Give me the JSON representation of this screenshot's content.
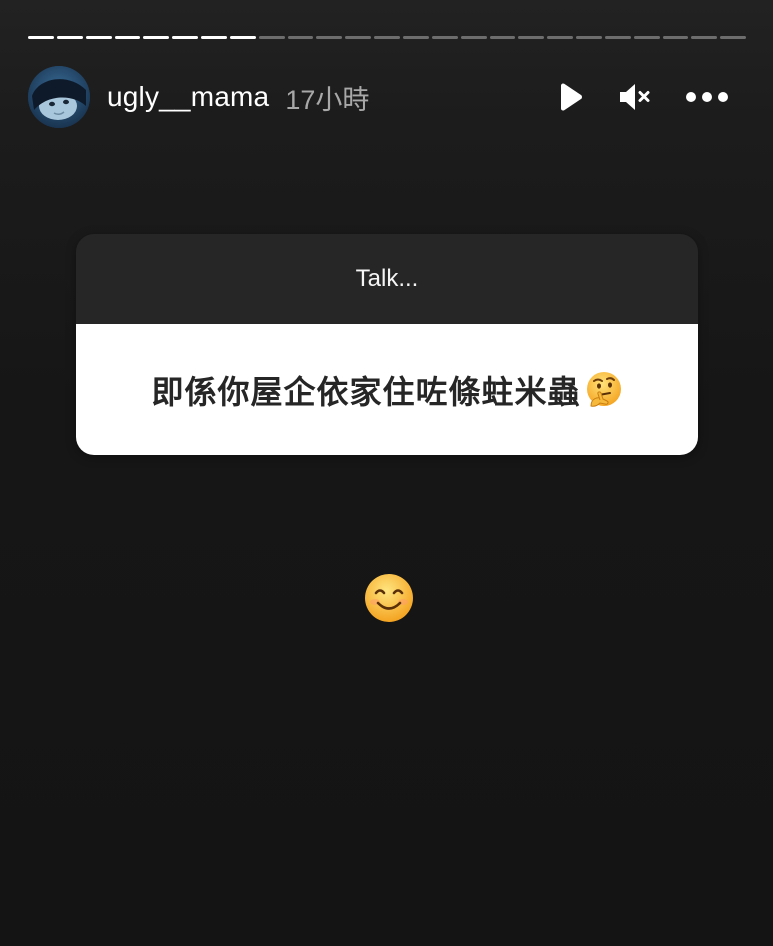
{
  "progress": {
    "total_segments": 25,
    "completed_segments": 8
  },
  "header": {
    "username": "ugly__mama",
    "time": "17小時"
  },
  "icons": {
    "play": "play-icon",
    "mute": "speaker-muted-icon",
    "more": "more-horizontal-icon",
    "thinking": "thinking-face-emoji",
    "smile": "smiling-face-emoji"
  },
  "question_card": {
    "prompt": "Talk...",
    "answer": "即係你屋企依家住咗條蛀米蟲"
  },
  "colors": {
    "background": "#161616",
    "card_header": "#262626",
    "card_body": "#ffffff",
    "text_light": "#ffffff",
    "text_muted": "#a8a8a8"
  }
}
